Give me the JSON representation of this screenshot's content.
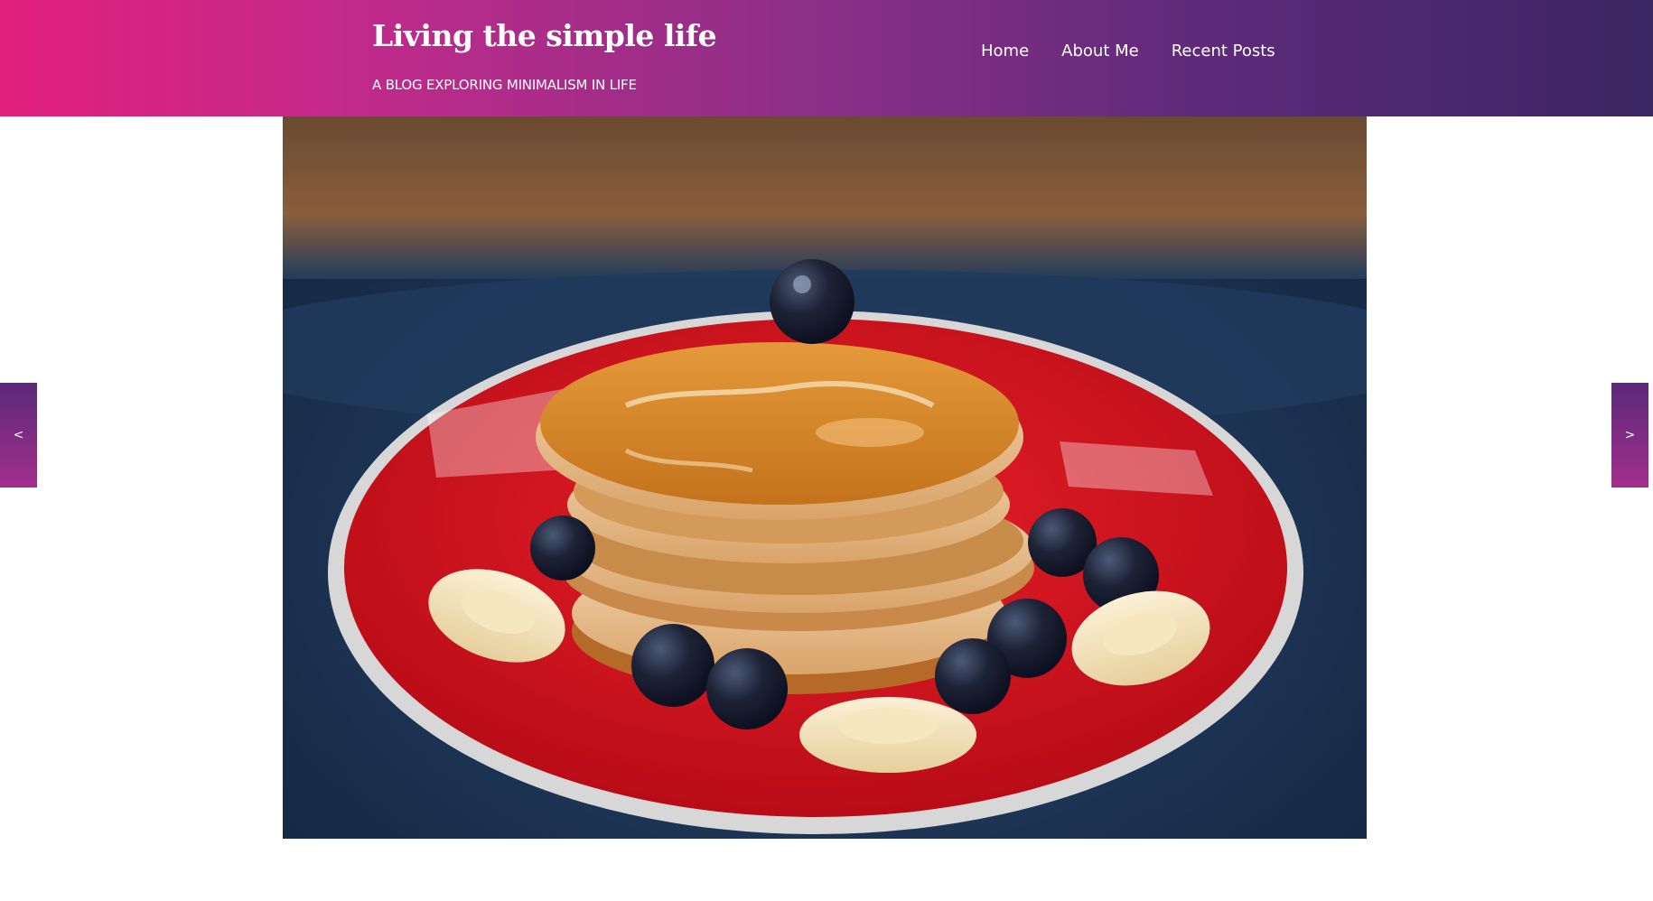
{
  "header": {
    "title": "Living the simple life",
    "tagline": "A BLOG EXPLORING MINIMALISM IN LIFE"
  },
  "nav": {
    "items": [
      {
        "label": "Home"
      },
      {
        "label": "About Me"
      },
      {
        "label": "Recent Posts"
      }
    ]
  },
  "slider": {
    "prev_label": "<",
    "next_label": ">",
    "image_icon": "pancake-stack-photo"
  },
  "colors": {
    "gradient_start": "#e21f7c",
    "gradient_end": "#3b2563",
    "plate_red": "#d8101e",
    "table_blue": "#1f3552"
  }
}
